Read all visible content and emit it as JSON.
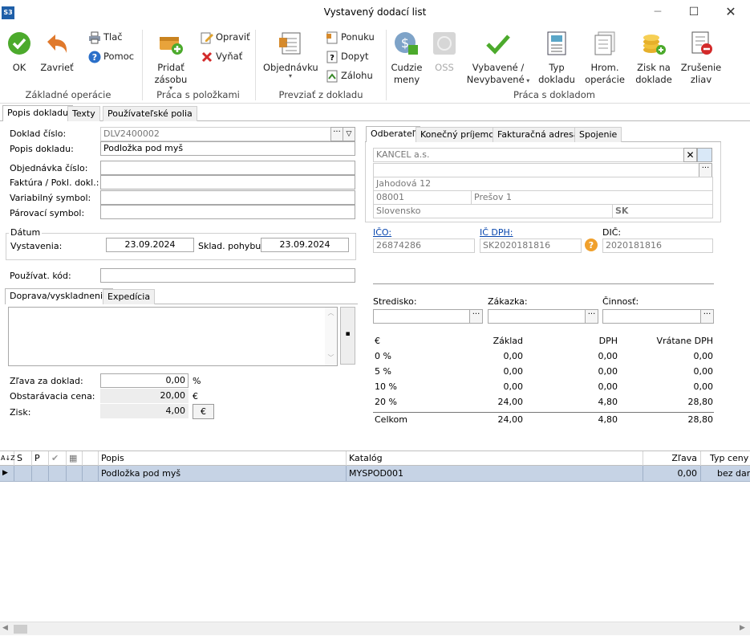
{
  "window": {
    "title": "Vystavený dodací list",
    "app_icon": "S3"
  },
  "ribbon": {
    "ok": "OK",
    "close": "Zavrieť",
    "print": "Tlač",
    "help": "Pomoc",
    "group_basic": "Základné operácie",
    "add_stock_1": "Pridať",
    "add_stock_2": "zásobu",
    "edit": "Opraviť",
    "remove": "Vyňať",
    "group_items": "Práca s položkami",
    "orders": "Objednávku",
    "offer": "Ponuku",
    "demand": "Dopyt",
    "advances": "Zálohu",
    "group_take": "Prevziať z dokladu",
    "foreign_1": "Cudzie",
    "foreign_2": "meny",
    "oss": "OSS",
    "done_1": "Vybavené /",
    "done_2": "Nevybavené",
    "type_1": "Typ",
    "type_2": "dokladu",
    "bulk_1": "Hrom.",
    "bulk_2": "operácie",
    "profit_1": "Zisk na",
    "profit_2": "doklade",
    "cancel_1": "Zrušenie",
    "cancel_2": "zliav",
    "group_doc": "Práca s dokladom"
  },
  "tabs": [
    "Popis dokladu",
    "Texty",
    "Používateľské polia"
  ],
  "form": {
    "doc_number_label": "Doklad číslo:",
    "doc_number": "DLV2400002",
    "doc_desc_label": "Popis dokladu:",
    "doc_desc": "Podložka pod myš",
    "order_no_label": "Objednávka číslo:",
    "invoice_label": "Faktúra / Pokl. dokl.:",
    "var_symbol_label": "Variabilný symbol:",
    "pair_symbol_label": "Párovací symbol:",
    "date_group": "Dátum",
    "issued_label": "Vystavenia:",
    "issued": "23.09.2024",
    "stock_move_label": "Sklad. pohybu:",
    "stock_move": "23.09.2024",
    "user_code_label": "Používat. kód:"
  },
  "subtabs": [
    "Doprava/vyskladnenie",
    "Expedícia"
  ],
  "discount": {
    "label": "Zľava za doklad:",
    "value": "0,00",
    "unit": "%",
    "cost_label": "Obstarávacia cena:",
    "cost": "20,00",
    "cost_unit": "€",
    "profit_label": "Zisk:",
    "profit": "4,00",
    "currency_button": "€"
  },
  "partner_tabs": [
    "Odberateľ",
    "Konečný príjemca",
    "Fakturačná adresa",
    "Spojenie"
  ],
  "partner": {
    "name": "KANCEL a.s.",
    "street": "Jahodová 12",
    "zip": "08001",
    "city": "Prešov 1",
    "country": "Slovensko",
    "country_code": "SK",
    "ico_label": "IČO:",
    "ico": "26874286",
    "icdph_label": "IČ DPH:",
    "icdph": "SK2020181816",
    "dic_label": "DIČ:",
    "dic": "2020181816"
  },
  "cost": {
    "center_label": "Stredisko:",
    "contract_label": "Zákazka:",
    "activity_label": "Činnosť:"
  },
  "vat": {
    "headers": [
      "€",
      "Základ",
      "DPH",
      "Vrátane DPH"
    ],
    "rows": [
      [
        "0 %",
        "0,00",
        "0,00",
        "0,00"
      ],
      [
        "5 %",
        "0,00",
        "0,00",
        "0,00"
      ],
      [
        "10 %",
        "0,00",
        "0,00",
        "0,00"
      ],
      [
        "20 %",
        "24,00",
        "4,80",
        "28,80"
      ]
    ],
    "total": [
      "Celkom",
      "24,00",
      "4,80",
      "28,80"
    ]
  },
  "grid": {
    "sort_glyph": "A↓Z",
    "headers": [
      "S",
      "P",
      "Popis",
      "Katalóg",
      "Zľava",
      "Typ ceny"
    ],
    "rows": [
      {
        "desc": "Podložka pod myš",
        "catalog": "MYSPOD001",
        "discount": "0,00",
        "price_type": "bez dan"
      }
    ]
  }
}
